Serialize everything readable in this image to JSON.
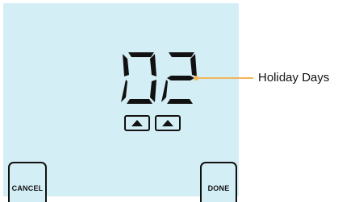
{
  "display": {
    "value": "02",
    "segment_color": "#111111",
    "background_color": "#d4eef5"
  },
  "controls": {
    "up_arrow_icon": "up-triangle",
    "cancel_label": "CANCEL",
    "done_label": "DONE"
  },
  "callout": {
    "label": "Holiday Days",
    "color": "#f2b45a"
  }
}
